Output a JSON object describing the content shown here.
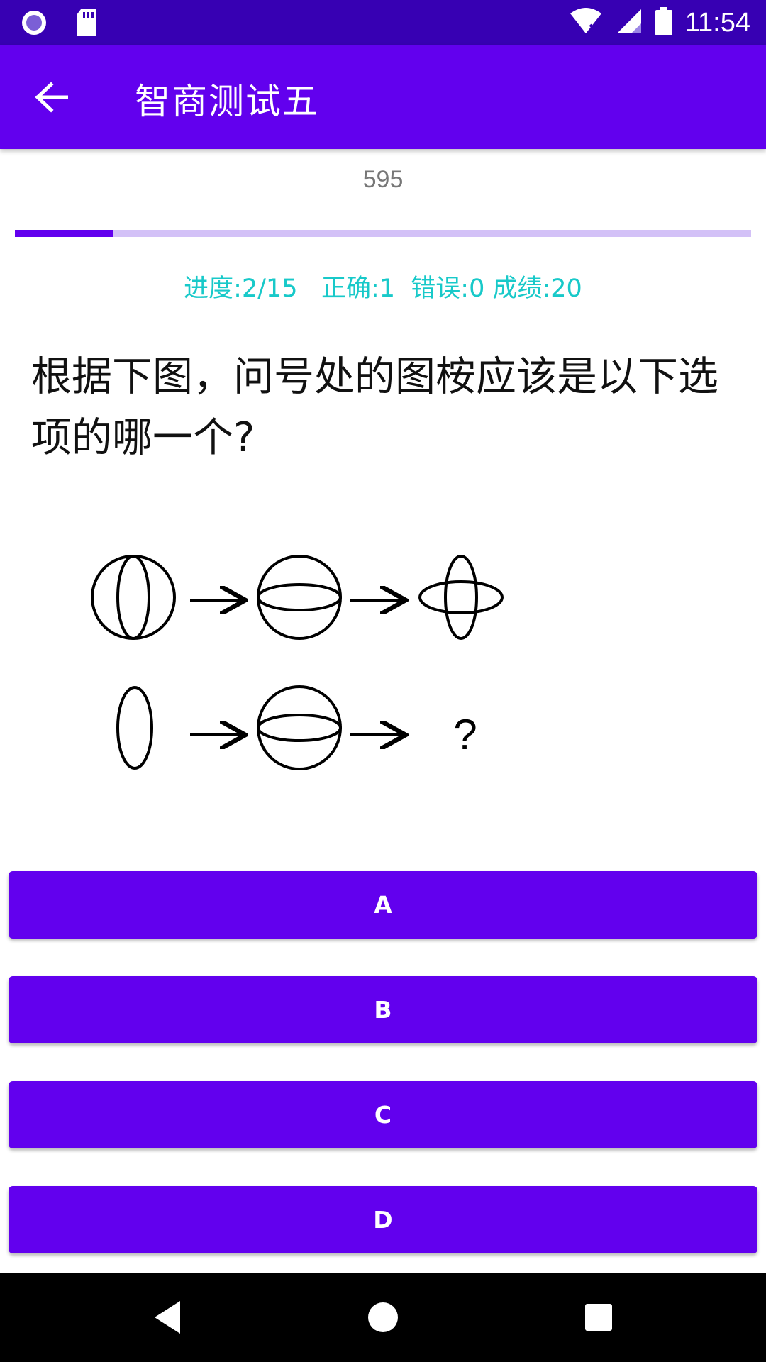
{
  "status_bar": {
    "time": "11:54",
    "icons": [
      "record-icon",
      "sd-card-icon",
      "wifi-icon",
      "signal-icon",
      "battery-icon"
    ]
  },
  "app_bar": {
    "title": "智商测试五",
    "back_icon": "arrow-left-icon"
  },
  "timer": "595",
  "progress": {
    "fraction": 0.133
  },
  "stats": {
    "progress_label": "进度:2/15",
    "correct_label": "正确:1",
    "wrong_label": "错误:0",
    "score_label": "成绩:20"
  },
  "question": {
    "text": "根据下图，问号处的图桉应该是以下选项的哪一个?",
    "figure_question_mark": "?"
  },
  "answers": [
    {
      "label": "A"
    },
    {
      "label": "B"
    },
    {
      "label": "C"
    },
    {
      "label": "D"
    }
  ],
  "nav_bar": {
    "icons": [
      "back-triangle-icon",
      "home-circle-icon",
      "recents-square-icon"
    ]
  },
  "colors": {
    "status_bar": "#3700b3",
    "primary": "#6200ee",
    "progress_track": "#d3c1f7",
    "stats_text": "#18c9c9",
    "nav_bar": "#000000"
  }
}
